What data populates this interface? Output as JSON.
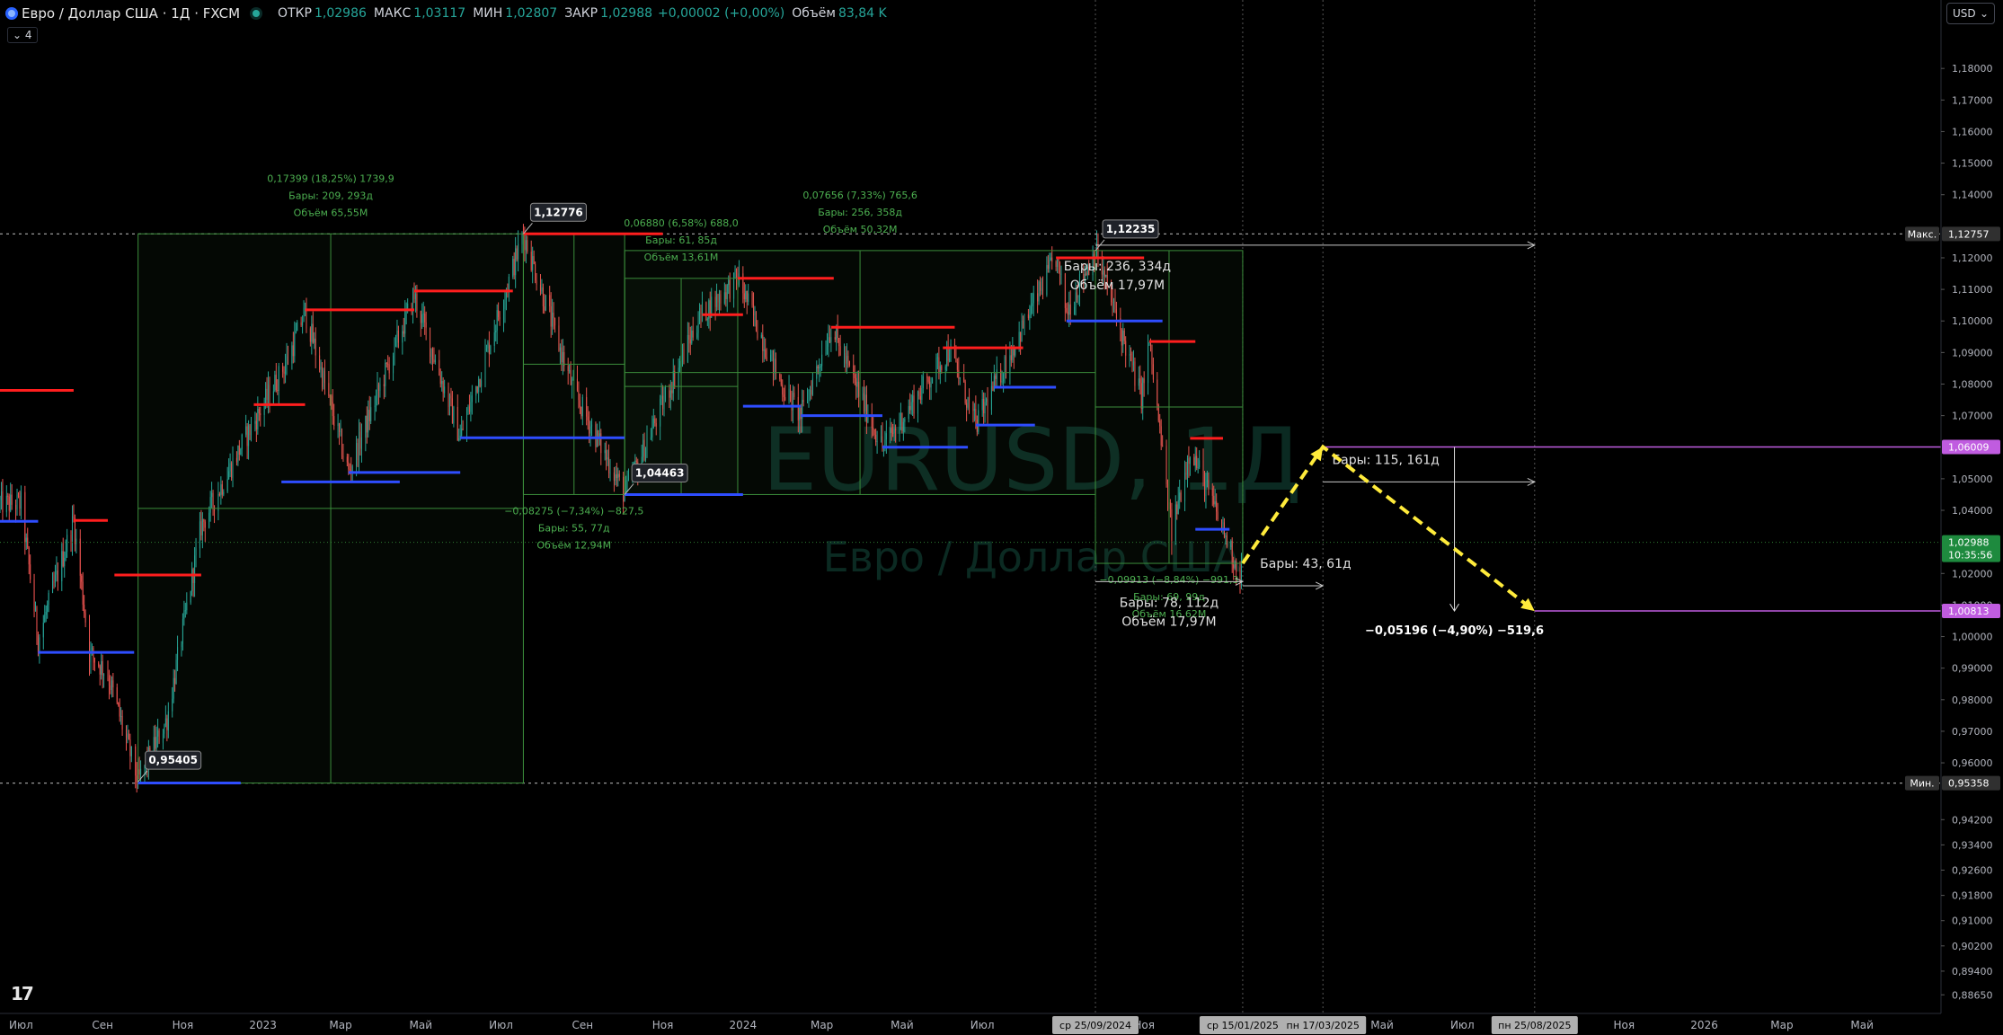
{
  "header": {
    "symbol": "Евро / Доллар США · 1Д · FXCM",
    "o_label": "ОТКР",
    "o": "1,02986",
    "h_label": "МАКС",
    "h": "1,03117",
    "l_label": "МИН",
    "l": "1,02807",
    "c_label": "ЗАКР",
    "c": "1,02988",
    "chg": "+0,00002 (+0,00%)",
    "vol_label": "Объём",
    "vol": "83,84 K",
    "indicator_count": "4"
  },
  "currency": "USD",
  "watermark": {
    "ticker": "EURUSD, 1Д",
    "name": "Евро / Доллар США"
  },
  "colors": {
    "bg": "#000000",
    "up": "#26a69a",
    "down": "#ef5350",
    "res": "#ff1e1e",
    "sup": "#2e4dff",
    "measure": "#3b8d3b",
    "measure_text": "#4caf50",
    "purple": "#c05ce0",
    "proj": "#ffeb3b",
    "price_tag": "#1e8a3e"
  },
  "chart_data": {
    "type": "candlestick",
    "title": "Евро / Доллар США · 1Д · FXCM",
    "x_start": "2022-06-15",
    "x_end": "2026-06-30",
    "ylim": [
      0.8806,
      1.1903
    ],
    "y_ticks": [
      "1,18000",
      "1,17000",
      "1,16000",
      "1,15000",
      "1,14000",
      "1,12000",
      "1,11000",
      "1,10000",
      "1,09000",
      "1,08000",
      "1,07000",
      "1,05000",
      "1,04000",
      "1,02000",
      "1,01000",
      "1,00000",
      "0,99000",
      "0,98000",
      "0,97000",
      "0,96000",
      "0,94200",
      "0,93400",
      "0,92600",
      "0,91800",
      "0,91000",
      "0,90200",
      "0,89400",
      "0,88650"
    ],
    "x_ticks": [
      {
        "date": "2022-07-01",
        "label": "Июл"
      },
      {
        "date": "2022-09-01",
        "label": "Сен"
      },
      {
        "date": "2022-11-01",
        "label": "Ноя"
      },
      {
        "date": "2023-01-01",
        "label": "2023"
      },
      {
        "date": "2023-03-01",
        "label": "Мар"
      },
      {
        "date": "2023-05-01",
        "label": "Май"
      },
      {
        "date": "2023-07-01",
        "label": "Июл"
      },
      {
        "date": "2023-09-01",
        "label": "Сен"
      },
      {
        "date": "2023-11-01",
        "label": "Ноя"
      },
      {
        "date": "2024-01-01",
        "label": "2024"
      },
      {
        "date": "2024-03-01",
        "label": "Мар"
      },
      {
        "date": "2024-05-01",
        "label": "Май"
      },
      {
        "date": "2024-07-01",
        "label": "Июл"
      },
      {
        "date": "2024-11-01",
        "label": "Ноя"
      },
      {
        "date": "2025-05-01",
        "label": "Май"
      },
      {
        "date": "2025-07-01",
        "label": "Июл"
      },
      {
        "date": "2025-11-01",
        "label": "Ноя"
      },
      {
        "date": "2026-01-01",
        "label": "2026"
      },
      {
        "date": "2026-03-01",
        "label": "Мар"
      },
      {
        "date": "2026-05-01",
        "label": "Май"
      }
    ],
    "x_tags": [
      {
        "date": "2024-09-25",
        "label": "ср 25/09/2024"
      },
      {
        "date": "2025-01-15",
        "label": "ср 15/01/2025"
      },
      {
        "date": "2025-03-17",
        "label": "пн 17/03/2025"
      },
      {
        "date": "2025-08-25",
        "label": "пн 25/08/2025"
      }
    ],
    "price_path": [
      [
        "2022-06-15",
        1.042
      ],
      [
        "2022-07-01",
        1.042
      ],
      [
        "2022-07-14",
        0.999
      ],
      [
        "2022-08-10",
        1.0368
      ],
      [
        "2022-08-22",
        0.995
      ],
      [
        "2022-09-05",
        0.988
      ],
      [
        "2022-09-28",
        0.954
      ],
      [
        "2022-10-20",
        0.974
      ],
      [
        "2022-11-15",
        1.035
      ],
      [
        "2022-12-15",
        1.06
      ],
      [
        "2023-01-20",
        1.088
      ],
      [
        "2023-02-02",
        1.103
      ],
      [
        "2023-03-07",
        1.052
      ],
      [
        "2023-04-26",
        1.108
      ],
      [
        "2023-05-31",
        1.063
      ],
      [
        "2023-07-18",
        1.1276
      ],
      [
        "2023-08-25",
        1.078
      ],
      [
        "2023-10-03",
        1.045
      ],
      [
        "2023-11-29",
        1.1015
      ],
      [
        "2023-12-28",
        1.1135
      ],
      [
        "2024-01-31",
        1.079
      ],
      [
        "2024-02-14",
        1.07
      ],
      [
        "2024-03-08",
        1.098
      ],
      [
        "2024-04-16",
        1.06
      ],
      [
        "2024-06-06",
        1.091
      ],
      [
        "2024-06-26",
        1.067
      ],
      [
        "2024-08-26",
        1.12
      ],
      [
        "2024-09-03",
        1.103
      ],
      [
        "2024-09-25",
        1.1223
      ],
      [
        "2024-10-30",
        1.076
      ],
      [
        "2024-11-05",
        1.093
      ],
      [
        "2024-11-22",
        1.033
      ],
      [
        "2024-12-06",
        1.06
      ],
      [
        "2024-12-31",
        1.034
      ],
      [
        "2025-01-13",
        1.019
      ],
      [
        "2025-01-15",
        1.0299
      ]
    ],
    "hlines": [
      {
        "name": "Макс.",
        "price": 1.12757,
        "label": "1,12757"
      },
      {
        "name": "Мин.",
        "price": 0.95358,
        "label": "0,95358"
      }
    ],
    "levels": [
      {
        "kind": "res",
        "price": 1.078,
        "from": "2022-06-15",
        "to": "2022-08-10"
      },
      {
        "kind": "res",
        "price": 1.0368,
        "from": "2022-08-10",
        "to": "2022-09-05"
      },
      {
        "kind": "res",
        "price": 1.0195,
        "from": "2022-09-10",
        "to": "2022-11-15"
      },
      {
        "kind": "res",
        "price": 1.0735,
        "from": "2022-12-25",
        "to": "2023-02-02"
      },
      {
        "kind": "res",
        "price": 1.1035,
        "from": "2023-02-02",
        "to": "2023-04-26"
      },
      {
        "kind": "res",
        "price": 1.1095,
        "from": "2023-04-26",
        "to": "2023-07-10"
      },
      {
        "kind": "res",
        "price": 1.1276,
        "from": "2023-07-18",
        "to": "2023-11-01"
      },
      {
        "kind": "res",
        "price": 1.102,
        "from": "2023-12-01",
        "to": "2024-01-01"
      },
      {
        "kind": "res",
        "price": 1.1135,
        "from": "2023-12-28",
        "to": "2024-03-10"
      },
      {
        "kind": "res",
        "price": 1.098,
        "from": "2024-03-08",
        "to": "2024-06-10"
      },
      {
        "kind": "res",
        "price": 1.0915,
        "from": "2024-06-01",
        "to": "2024-08-01"
      },
      {
        "kind": "res",
        "price": 1.12,
        "from": "2024-08-26",
        "to": "2024-11-01"
      },
      {
        "kind": "res",
        "price": 1.0935,
        "from": "2024-11-05",
        "to": "2024-12-10"
      },
      {
        "kind": "res",
        "price": 1.0628,
        "from": "2024-12-06",
        "to": "2024-12-31"
      },
      {
        "kind": "sup",
        "price": 1.0365,
        "from": "2022-06-15",
        "to": "2022-07-14"
      },
      {
        "kind": "sup",
        "price": 0.995,
        "from": "2022-07-14",
        "to": "2022-09-25"
      },
      {
        "kind": "sup",
        "price": 0.9536,
        "from": "2022-09-28",
        "to": "2022-12-15"
      },
      {
        "kind": "sup",
        "price": 1.049,
        "from": "2023-01-15",
        "to": "2023-04-15"
      },
      {
        "kind": "sup",
        "price": 1.052,
        "from": "2023-03-07",
        "to": "2023-05-31"
      },
      {
        "kind": "sup",
        "price": 1.063,
        "from": "2023-05-31",
        "to": "2023-10-03"
      },
      {
        "kind": "sup",
        "price": 1.045,
        "from": "2023-10-03",
        "to": "2024-01-01"
      },
      {
        "kind": "sup",
        "price": 1.073,
        "from": "2024-01-01",
        "to": "2024-02-14"
      },
      {
        "kind": "sup",
        "price": 1.07,
        "from": "2024-02-14",
        "to": "2024-04-16"
      },
      {
        "kind": "sup",
        "price": 1.06,
        "from": "2024-04-16",
        "to": "2024-06-20"
      },
      {
        "kind": "sup",
        "price": 1.067,
        "from": "2024-06-26",
        "to": "2024-08-10"
      },
      {
        "kind": "sup",
        "price": 1.079,
        "from": "2024-07-10",
        "to": "2024-08-26"
      },
      {
        "kind": "sup",
        "price": 1.1,
        "from": "2024-09-03",
        "to": "2024-11-15"
      },
      {
        "kind": "sup",
        "price": 1.034,
        "from": "2024-12-10",
        "to": "2025-01-05"
      }
    ],
    "price_callouts": [
      {
        "date": "2023-07-18",
        "price": 1.1276,
        "label": "1,12776",
        "pos": "above"
      },
      {
        "date": "2024-09-25",
        "price": 1.1223,
        "label": "1,12235",
        "pos": "above"
      },
      {
        "date": "2023-10-03",
        "price": 1.045,
        "label": "1,04463",
        "pos": "above"
      },
      {
        "date": "2022-09-28",
        "price": 0.954,
        "label": "0,95405",
        "pos": "above"
      }
    ],
    "measures": [
      {
        "x1": "2022-09-28",
        "x2": "2023-07-18",
        "y1": 0.9536,
        "y2": 1.1276,
        "lines": [
          "0,17399 (18,25%) 1739,9",
          "Бары: 209, 293д",
          "Объём 65,55М"
        ],
        "label_pos": "top"
      },
      {
        "x1": "2023-07-18",
        "x2": "2023-10-03",
        "y1": 1.045,
        "y2": 1.1276,
        "lines": [
          "−0,08275 (−7,34%) −827,5",
          "Бары: 55, 77д",
          "Объём 12,94М"
        ],
        "label_pos": "bottom"
      },
      {
        "x1": "2023-10-03",
        "x2": "2023-12-28",
        "y1": 1.045,
        "y2": 1.1135,
        "lines": [
          "0,06880 (6,58%) 688,0",
          "Бары: 61, 85д",
          "Объём 13,61М"
        ],
        "label_pos": "top"
      },
      {
        "x1": "2023-10-03",
        "x2": "2024-09-25",
        "y1": 1.045,
        "y2": 1.1223,
        "lines": [
          "0,07656 (7,33%) 765,6",
          "Бары: 256, 358д",
          "Объём 50,32М"
        ],
        "label_pos": "top"
      },
      {
        "x1": "2024-09-25",
        "x2": "2025-01-15",
        "y1": 1.0232,
        "y2": 1.1223,
        "lines": [
          "−0,09913 (−8,84%) −991,3",
          "Бары: 69, 99д",
          "Объём 16,62М"
        ],
        "label_pos": "bottom"
      }
    ],
    "range_arrows": [
      {
        "x1": "2024-09-25",
        "x2": "2025-01-15",
        "y": 1.0174,
        "lines": [
          "Бары: 78, 112д",
          "Объём 17,97М"
        ],
        "label": "below"
      },
      {
        "x1": "2024-09-25",
        "x2": "2025-08-25",
        "y": 1.124,
        "lines": [
          "Бары: 236, 334д",
          "Объём 17,97М"
        ],
        "label": "below"
      },
      {
        "x1": "2025-01-15",
        "x2": "2025-03-17",
        "y": 1.0161,
        "lines": [
          "Бары: 43, 61д"
        ],
        "label": "above"
      },
      {
        "x1": "2025-03-17",
        "x2": "2025-08-25",
        "y": 1.049,
        "lines": [
          "Бары: 115, 161д"
        ],
        "label": "above"
      }
    ],
    "projection": {
      "points": [
        [
          "2025-01-15",
          1.0232
        ],
        [
          "2025-03-17",
          1.0601
        ],
        [
          "2025-08-25",
          1.0081
        ]
      ]
    },
    "target_levels": [
      {
        "price": 1.06009,
        "label": "1,06009",
        "from": "2025-03-17"
      },
      {
        "price": 1.00813,
        "label": "1,00813",
        "from": "2025-08-25"
      }
    ],
    "vertical_measure": {
      "date": "2025-06-25",
      "y1": 1.0601,
      "y2": 1.0081,
      "label": "−0,05196 (−4,90%) −519,6"
    },
    "current_price": {
      "price": 1.02988,
      "label": "1,02988",
      "countdown": "10:35:56"
    },
    "vlines": [
      "2024-09-25",
      "2025-01-15",
      "2025-03-17",
      "2025-08-25"
    ]
  }
}
